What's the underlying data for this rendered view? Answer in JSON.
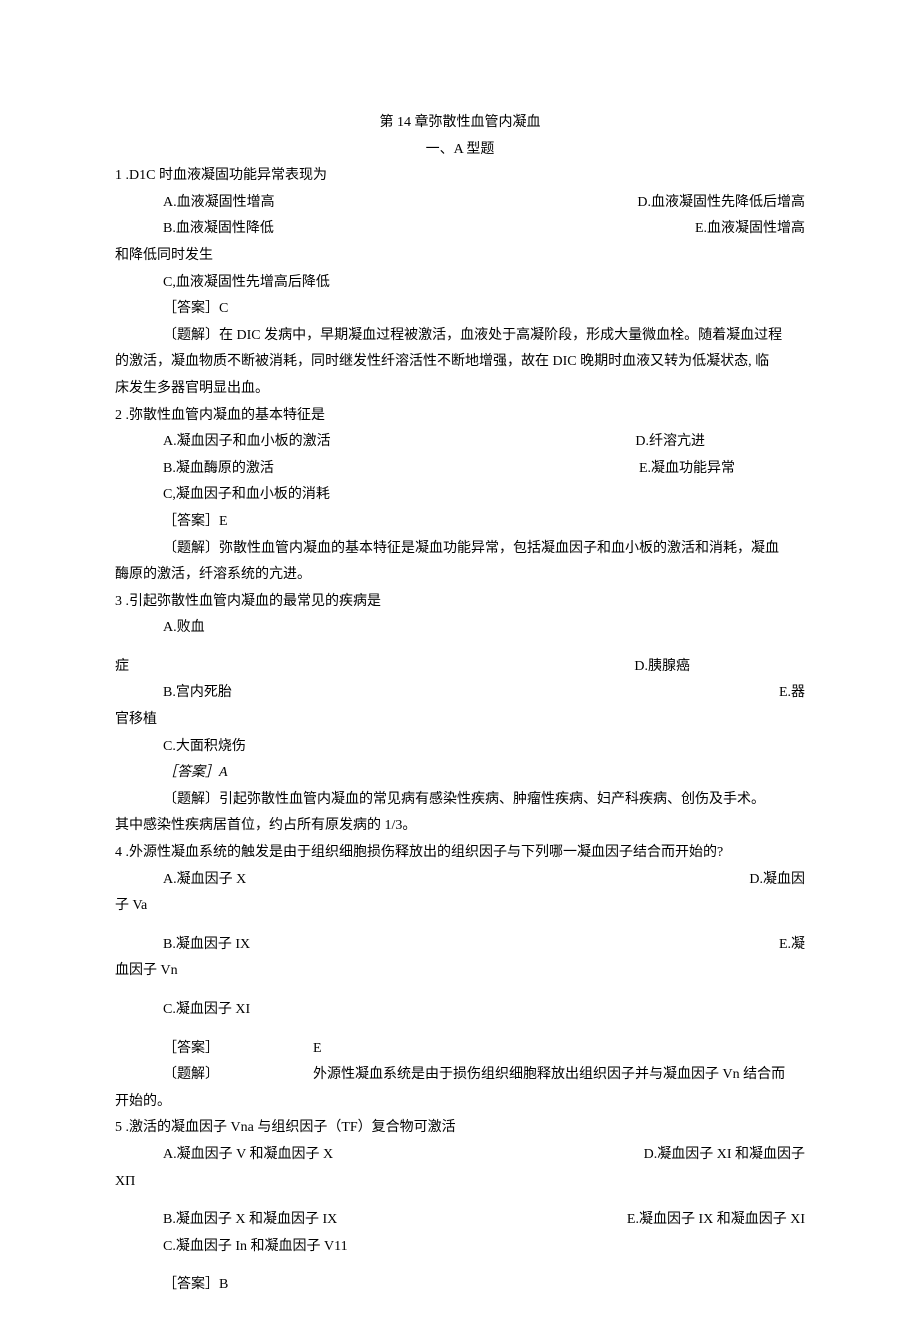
{
  "title": "第 14 章弥散性血管内凝血",
  "section": "一、A 型题",
  "q1": {
    "num": "1  .D1C 时血液凝固功能异常表现为",
    "a": "A.血液凝固性增高",
    "d": "D.血液凝固性先降低后增高",
    "b": "B.血液凝固性降低",
    "e": "E.血液凝固性增高",
    "tail": "和降低同时发生",
    "c": "C,血液凝固性先增高后降低",
    "ans": "［答案］C",
    "exp1": "〔题解〕在 DIC 发病中，早期凝血过程被激活，血液处于高凝阶段，形成大量微血栓。随着凝血过程",
    "exp2": "的激活，凝血物质不断被消耗，同时继发性纤溶活性不断地增强，故在 DIC 晚期时血液又转为低凝状态, 临",
    "exp3": "床发生多器官明显出血。"
  },
  "q2": {
    "num": "2  .弥散性血管内凝血的基本特征是",
    "a": "A.凝血因子和血小板的激活",
    "d": "D.纤溶亢进",
    "b": "B.凝血酶原的激活",
    "e": "E.凝血功能异常",
    "c": "C,凝血因子和血小板的消耗",
    "ans": "［答案］E",
    "exp1": "〔题解〕弥散性血管内凝血的基本特征是凝血功能异常，包括凝血因子和血小板的激活和消耗，凝血",
    "exp2": "酶原的激活，纤溶系统的亢进。"
  },
  "q3": {
    "num": "3  .引起弥散性血管内凝血的最常见的疾病是",
    "a": "A.败血",
    "line_zheng": "症",
    "d": "D.胰腺癌",
    "b": "B.宫内死胎",
    "e": "E.器",
    "tail": "官移植",
    "c": "C.大面积烧伤",
    "ans": "［答案］A",
    "exp1": "〔题解〕引起弥散性血管内凝血的常见病有感染性疾病、肿瘤性疾病、妇产科疾病、创伤及手术。",
    "exp2": "其中感染性疾病居首位，约占所有原发病的 1/3。"
  },
  "q4": {
    "num": "4  .外源性凝血系统的触发是由于组织细胞损伤释放出的组织因子与下列哪一凝血因子结合而开始的?",
    "a": "A.凝血因子 X",
    "d": "D.凝血因",
    "tail1": "子 Va",
    "b": "B.凝血因子 IX",
    "e": "E.凝",
    "tail2": "血因子 Vn",
    "c": "C.凝血因子 XI",
    "ans_lbl": "［答案］",
    "ans_val": "E",
    "exp_lbl": "〔题解〕",
    "exp_val": "外源性凝血系统是由于损伤组织细胞释放出组织因子并与凝血因子 Vn 结合而",
    "exp_tail": "开始的。"
  },
  "q5": {
    "num": "5  .激活的凝血因子 Vna 与组织因子（TF）复合物可激活",
    "a": "A.凝血因子 V 和凝血因子 X",
    "d": "D.凝血因子 XI 和凝血因子",
    "tail": "XΠ",
    "b": "B.凝血因子 X 和凝血因子 IX",
    "e": "E.凝血因子 IX 和凝血因子 XI",
    "c": "C.凝血因子 In 和凝血因子 V11",
    "ans": "［答案］B"
  }
}
